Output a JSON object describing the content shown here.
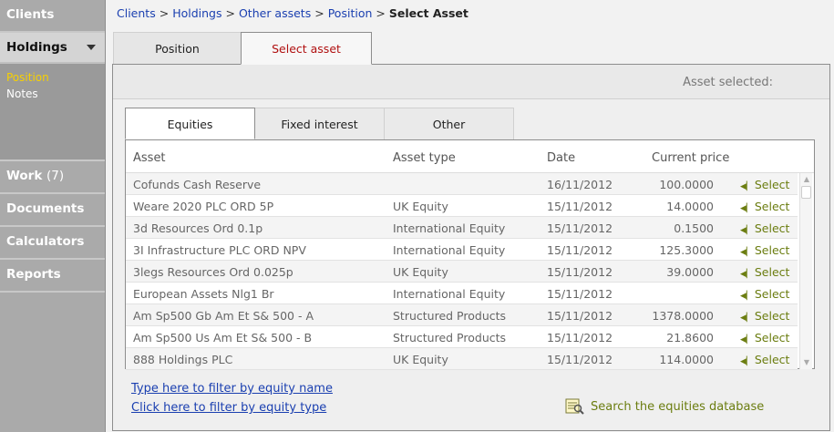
{
  "sidebar": {
    "items": [
      {
        "label": "Clients"
      },
      {
        "label": "Holdings"
      },
      {
        "label": "Work",
        "count": "(7)"
      },
      {
        "label": "Documents"
      },
      {
        "label": "Calculators"
      },
      {
        "label": "Reports"
      }
    ],
    "subitems": [
      {
        "label": "Position"
      },
      {
        "label": "Notes"
      }
    ]
  },
  "breadcrumb": {
    "items": [
      "Clients",
      "Holdings",
      "Other assets",
      "Position"
    ],
    "separator": ">",
    "current": "Select Asset"
  },
  "tabs": {
    "position": "Position",
    "select_asset": "Select asset"
  },
  "asset_selected_label": "Asset selected:",
  "asset_tabs": {
    "equities": "Equities",
    "fixed_interest": "Fixed interest",
    "other": "Other"
  },
  "table": {
    "columns": [
      "Asset",
      "Asset type",
      "Date",
      "Current price"
    ],
    "select_label": "Select",
    "rows": [
      {
        "asset": "Cofunds Cash Reserve",
        "type": "",
        "date": "16/11/2012",
        "price": "100.0000"
      },
      {
        "asset": "Weare 2020 PLC ORD 5P",
        "type": "UK Equity",
        "date": "15/11/2012",
        "price": "14.0000"
      },
      {
        "asset": "3d Resources Ord 0.1p",
        "type": "International Equity",
        "date": "15/11/2012",
        "price": "0.1500"
      },
      {
        "asset": "3I Infrastructure PLC ORD NPV",
        "type": "International Equity",
        "date": "15/11/2012",
        "price": "125.3000"
      },
      {
        "asset": "3legs Resources Ord 0.025p",
        "type": "UK Equity",
        "date": "15/11/2012",
        "price": "39.0000"
      },
      {
        "asset": "European Assets Nlg1 Br",
        "type": "International Equity",
        "date": "15/11/2012",
        "price": ""
      },
      {
        "asset": "Am Sp500 Gb Am Et S& 500 - A",
        "type": "Structured Products",
        "date": "15/11/2012",
        "price": "1378.0000"
      },
      {
        "asset": "Am Sp500 Us Am Et S& 500 - B",
        "type": "Structured Products",
        "date": "15/11/2012",
        "price": "21.8600"
      },
      {
        "asset": "888 Holdings PLC",
        "type": "UK Equity",
        "date": "15/11/2012",
        "price": "114.0000"
      }
    ]
  },
  "footer": {
    "filter_name": "Type here to filter by equity name",
    "filter_type": "Click here to filter by equity type",
    "search_db": "Search the equities database"
  }
}
